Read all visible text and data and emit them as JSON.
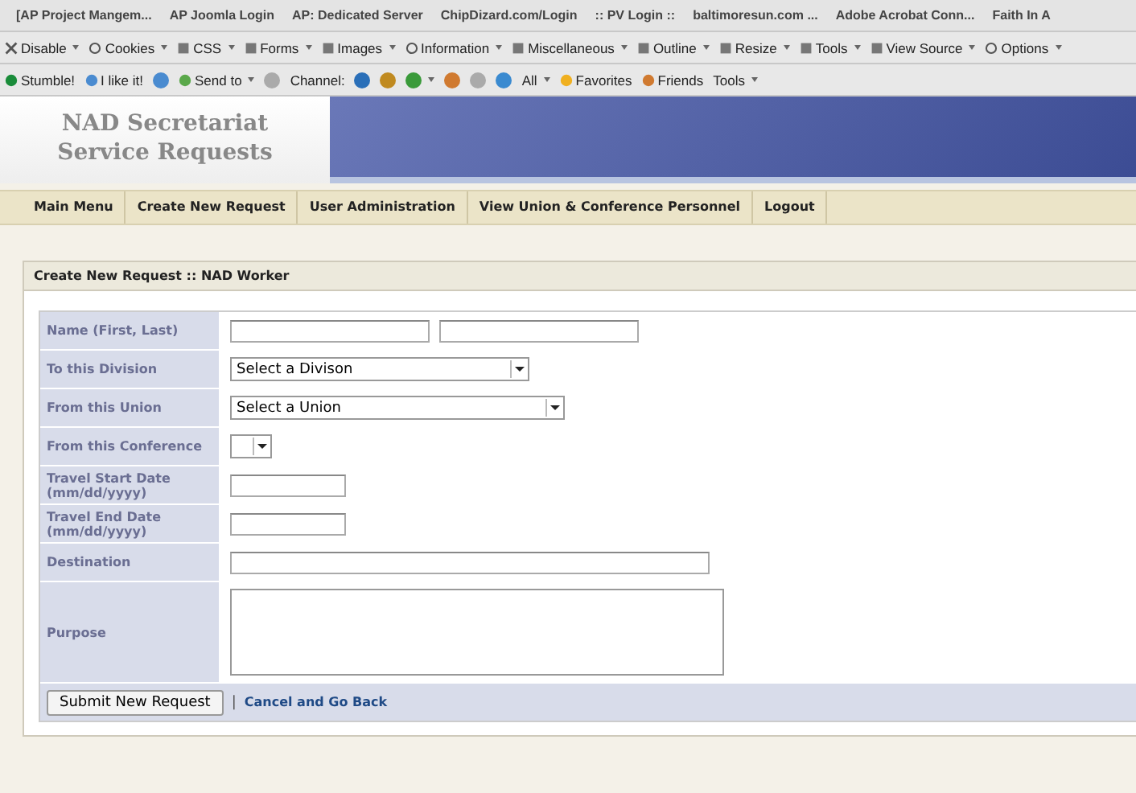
{
  "bookmarks": [
    "[AP Project Mangem...",
    "AP Joomla Login",
    "AP: Dedicated Server",
    "ChipDizard.com/Login",
    ":: PV Login ::",
    "baltimoresun.com ...",
    "Adobe Acrobat Conn...",
    "Faith In A"
  ],
  "dev_toolbar": [
    {
      "label": "Disable"
    },
    {
      "label": "Cookies"
    },
    {
      "label": "CSS"
    },
    {
      "label": "Forms"
    },
    {
      "label": "Images"
    },
    {
      "label": "Information"
    },
    {
      "label": "Miscellaneous"
    },
    {
      "label": "Outline"
    },
    {
      "label": "Resize"
    },
    {
      "label": "Tools"
    },
    {
      "label": "View Source"
    },
    {
      "label": "Options"
    }
  ],
  "social_toolbar": [
    {
      "kind": "button",
      "label": "Stumble!"
    },
    {
      "kind": "button",
      "label": "I like it!"
    },
    {
      "kind": "icon"
    },
    {
      "kind": "menu-button",
      "label": "Send to"
    },
    {
      "kind": "icon"
    },
    {
      "kind": "text",
      "label": "Channel:"
    },
    {
      "kind": "icon"
    },
    {
      "kind": "icon"
    },
    {
      "kind": "menu-icon"
    },
    {
      "kind": "icon"
    },
    {
      "kind": "icon"
    },
    {
      "kind": "icon"
    },
    {
      "kind": "menu-button",
      "label": "All"
    },
    {
      "kind": "button",
      "label": "Favorites"
    },
    {
      "kind": "button",
      "label": "Friends"
    },
    {
      "kind": "menu-button",
      "label": "Tools"
    }
  ],
  "site": {
    "title_lines": [
      "NAD Secretariat",
      "Service Requests"
    ]
  },
  "nav": [
    {
      "label": "Main Menu"
    },
    {
      "label": "Create New Request"
    },
    {
      "label": "User Administration"
    },
    {
      "label": "View Union & Conference Personnel"
    },
    {
      "label": "Logout"
    }
  ],
  "form": {
    "title": "Create New Request :: NAD Worker",
    "rows": [
      {
        "label": "Name (First, Last)",
        "kind": "double-text"
      },
      {
        "label": "To this Division",
        "kind": "select",
        "value": "Select a Divison"
      },
      {
        "label": "From this Union",
        "kind": "select",
        "value": "Select a Union"
      },
      {
        "label": "From this Conference",
        "kind": "select"
      },
      {
        "label": "Travel Start Date (mm/dd/yyyy)",
        "kind": "date"
      },
      {
        "label": "Travel End Date (mm/dd/yyyy)",
        "kind": "date"
      },
      {
        "label": "Destination",
        "kind": "text"
      },
      {
        "label": "Purpose",
        "kind": "textarea"
      }
    ],
    "submit": "Submit New Request",
    "separator": "|",
    "cancel": "Cancel and Go Back"
  }
}
